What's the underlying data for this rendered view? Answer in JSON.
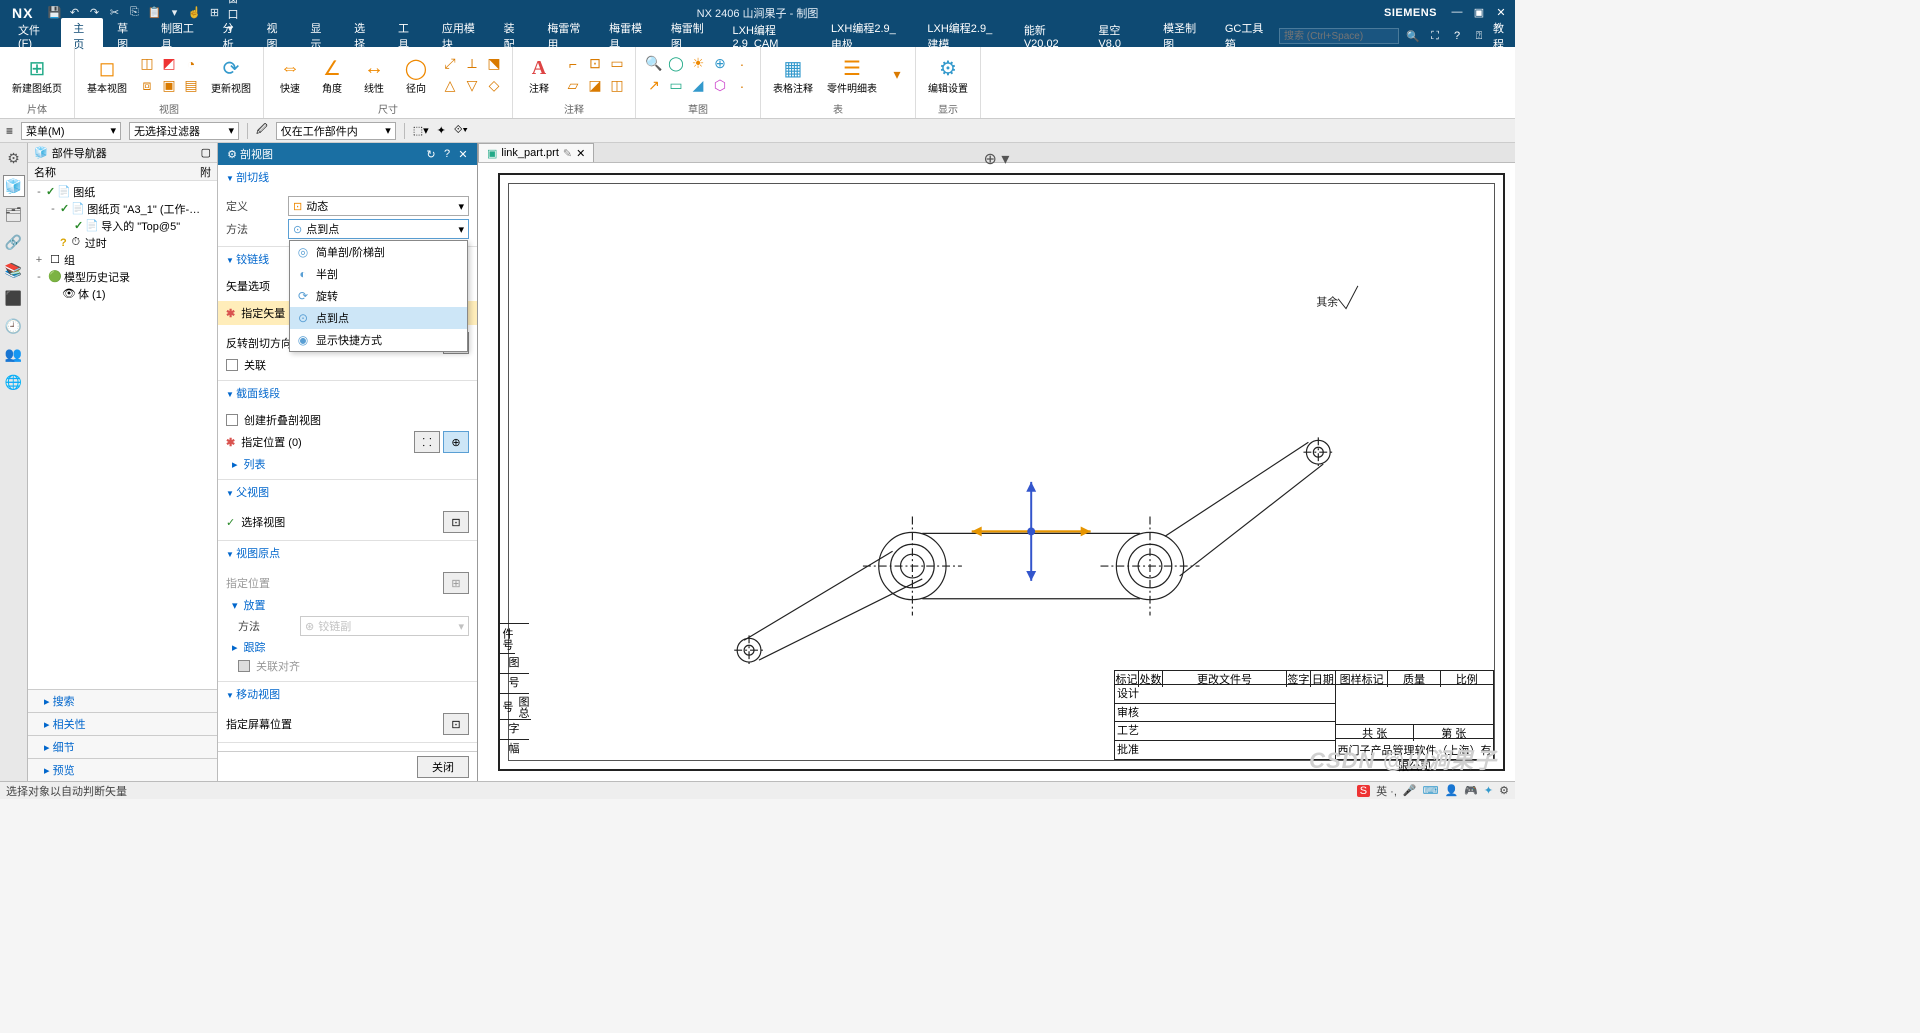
{
  "titlebar": {
    "logo": "NX",
    "title": "NX 2406 山涧果子 - 制图",
    "brand": "SIEMENS"
  },
  "menu": {
    "items": [
      "文件(F)",
      "主页",
      "草图",
      "制图工具",
      "分析",
      "视图",
      "显示",
      "选择",
      "工具",
      "应用模块",
      "装配",
      "梅雷常用",
      "梅雷模具",
      "梅雷制图",
      "LXH编程2.9_CAM",
      "LXH编程2.9_电极",
      "LXH编程2.9_建模",
      "能新 V20.02",
      "星空 V8.0",
      "模圣制图",
      "GC工具箱"
    ],
    "search_placeholder": "搜索 (Ctrl+Space)"
  },
  "ribbon": {
    "g1": {
      "btn": "新建图纸页",
      "label": "片体"
    },
    "g2": {
      "btns": [
        "基本视图",
        "",
        "更新视图"
      ],
      "label": "视图"
    },
    "g3": {
      "btns": [
        "快速",
        "角度",
        "线性",
        "径向"
      ],
      "label": "尺寸"
    },
    "g4": {
      "btn": "注释",
      "label": "注释"
    },
    "g5": {
      "label": "草图"
    },
    "g6": {
      "btns": [
        "表格注释",
        "零件明细表"
      ],
      "label": "表"
    },
    "g7": {
      "btn": "编辑设置",
      "label": "显示"
    }
  },
  "filter": {
    "menu": "菜单(M)",
    "f1": "无选择过滤器",
    "f2": "仅在工作部件内"
  },
  "nav": {
    "title": "部件导航器",
    "col": "名称",
    "tree": [
      {
        "depth": 0,
        "exp": "-",
        "chk": "✓",
        "ic": "📄",
        "txt": "图纸"
      },
      {
        "depth": 1,
        "exp": "-",
        "chk": "✓",
        "ic": "📄",
        "txt": "图纸页 \"A3_1\" (工作-…"
      },
      {
        "depth": 2,
        "exp": "",
        "chk": "✓",
        "ic": "📄",
        "txt": "导入的 \"Top@5\""
      },
      {
        "depth": 1,
        "exp": "",
        "chk": "?",
        "ic": "⏱",
        "txt": "过时",
        "chkcol": "#d9a400"
      },
      {
        "depth": 0,
        "exp": "+",
        "chk": "",
        "ic": "☐",
        "txt": "组"
      },
      {
        "depth": 0,
        "exp": "-",
        "chk": "",
        "ic": "🟢",
        "txt": "模型历史记录"
      },
      {
        "depth": 1,
        "exp": "",
        "chk": "",
        "ic": "👁",
        "txt": "体 (1)"
      }
    ],
    "acc": [
      "搜索",
      "相关性",
      "细节",
      "预览"
    ]
  },
  "dialog": {
    "title": "剖视图",
    "sec_cutline": "剖切线",
    "def_label": "定义",
    "def_value": "动态",
    "method_label": "方法",
    "method_value": "点到点",
    "method_opts": [
      {
        "ic": "◎",
        "txt": "简单剖/阶梯剖"
      },
      {
        "ic": "◐",
        "txt": "半剖"
      },
      {
        "ic": "⟳",
        "txt": "旋转"
      },
      {
        "ic": "⊙",
        "txt": "点到点",
        "hov": true
      },
      {
        "ic": "◉",
        "txt": "显示快捷方式"
      }
    ],
    "sec_hinge": "铰链线",
    "vec_opt": "矢量选项",
    "specify_vec": "指定矢量",
    "reverse": "反转剖切方向",
    "assoc": "关联",
    "sec_segment": "截面线段",
    "fold": "创建折叠剖视图",
    "spec_loc": "指定位置 (0)",
    "list": "列表",
    "sec_parent": "父视图",
    "select_view": "选择视图",
    "sec_origin": "视图原点",
    "spec_pos": "指定位置",
    "sec_place": "放置",
    "place_method": "方法",
    "place_value": "铰链副",
    "track": "跟踪",
    "align": "关联对齐",
    "sec_move": "移动视图",
    "screen_pos": "指定屏幕位置",
    "close": "关闭"
  },
  "doc": {
    "tab": "link_part.prt"
  },
  "drawing": {
    "note": "其余",
    "tb_company": "西门子产品管理软件（上海）有限公司",
    "tb_h": [
      "标记",
      "处数",
      "更改文件号",
      "签字",
      "日期"
    ],
    "tb_r": [
      "设计",
      "审核",
      "工艺",
      "批准"
    ],
    "tb_rh": [
      "图样标记",
      "质量",
      "比例"
    ],
    "tb_rb": [
      "共  张",
      "第  张"
    ]
  },
  "status": {
    "msg": "选择对象以自动判断矢量",
    "ime": "英 ·, "
  },
  "watermark": "CSDN @山涧果子"
}
